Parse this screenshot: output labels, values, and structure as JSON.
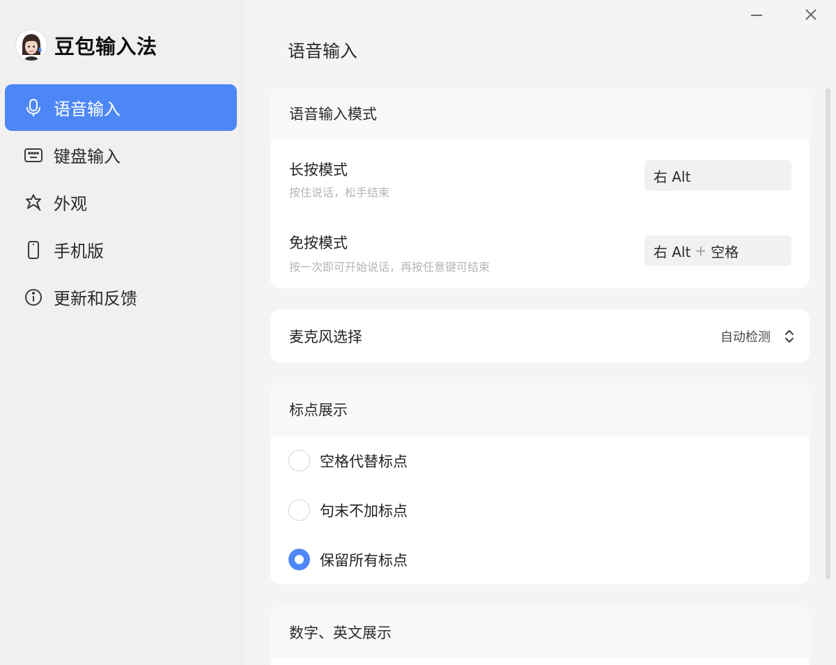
{
  "app": {
    "name": "豆包输入法",
    "accent_color": "#4d87f6"
  },
  "window_controls": {
    "minimize_icon": "minimize-icon",
    "close_icon": "close-icon"
  },
  "sidebar": {
    "items": [
      {
        "label": "语音输入",
        "icon": "microphone-icon",
        "active": true
      },
      {
        "label": "键盘输入",
        "icon": "keyboard-icon",
        "active": false
      },
      {
        "label": "外观",
        "icon": "appearance-icon",
        "active": false
      },
      {
        "label": "手机版",
        "icon": "phone-icon",
        "active": false
      },
      {
        "label": "更新和反馈",
        "icon": "info-icon",
        "active": false
      }
    ]
  },
  "main": {
    "title": "语音输入",
    "voice_mode": {
      "header": "语音输入模式",
      "long_press": {
        "title": "长按模式",
        "desc": "按住说话，松手结束",
        "key": "右 Alt"
      },
      "free_press": {
        "title": "免按模式",
        "desc": "按一次即可开始说话，再按任意键可结束",
        "key_part1": "右 Alt",
        "key_plus": "+",
        "key_part2": "空格"
      }
    },
    "microphone": {
      "label": "麦克风选择",
      "value": "自动检测"
    },
    "punctuation": {
      "header": "标点展示",
      "options": [
        {
          "label": "空格代替标点",
          "checked": false
        },
        {
          "label": "句末不加标点",
          "checked": false
        },
        {
          "label": "保留所有标点",
          "checked": true
        }
      ]
    },
    "numbers_english": {
      "header": "数字、英文展示"
    }
  }
}
